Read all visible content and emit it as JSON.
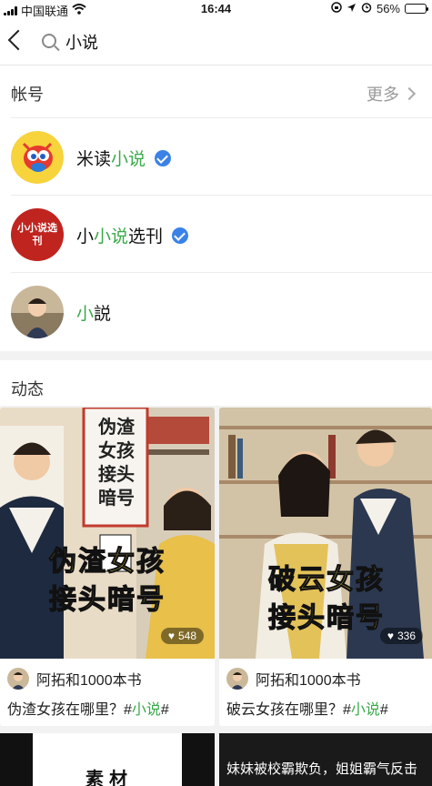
{
  "status": {
    "carrier": "中国联通",
    "time": "16:44",
    "battery": "56%",
    "battery_level": 0.56
  },
  "search": {
    "query": "小说"
  },
  "accounts": {
    "heading": "帐号",
    "more_label": "更多",
    "items": [
      {
        "pre": "米读",
        "hl": "小说",
        "post": "",
        "verified": true
      },
      {
        "pre": "小",
        "hl": "小说",
        "post": "选刊",
        "verified": true,
        "avatar_text": "小小说选刊"
      },
      {
        "pre": "",
        "hl": "小",
        "post": "説",
        "verified": false
      }
    ]
  },
  "feed": {
    "heading": "动态",
    "posts": [
      {
        "sign_text": "伪渣女孩 接头暗号",
        "caption_line1": "伪渣女孩",
        "caption_line2": "接头暗号",
        "likes": "548",
        "author": "阿拓和1000本书",
        "title_pre": "伪渣女孩在哪里？#",
        "title_hl": "小说",
        "title_post": "#"
      },
      {
        "caption_line1": "破云女孩",
        "caption_line2": "接头暗号",
        "likes": "336",
        "author": "阿拓和1000本书",
        "title_pre": "破云女孩在哪里？#",
        "title_hl": "小说",
        "title_post": "#"
      }
    ],
    "bottom": [
      {
        "text": "素材"
      },
      {
        "text": "妹妹被校霸欺负，姐姐霸气反击"
      }
    ]
  }
}
